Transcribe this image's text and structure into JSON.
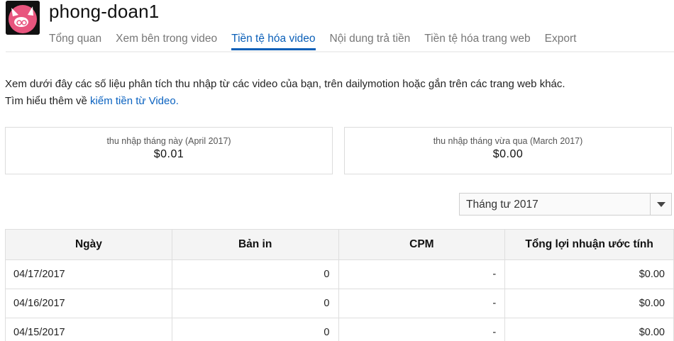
{
  "channel": {
    "name": "phong-doan1",
    "avatar_icon": "pink-mascot-icon"
  },
  "tabs": [
    {
      "label": "Tổng quan",
      "active": false
    },
    {
      "label": "Xem bên trong video",
      "active": false
    },
    {
      "label": "Tiền tệ hóa video",
      "active": true
    },
    {
      "label": "Nội dung trả tiền",
      "active": false
    },
    {
      "label": "Tiền tệ hóa trang web",
      "active": false
    },
    {
      "label": "Export",
      "active": false
    }
  ],
  "intro": {
    "line1": "Xem dưới đây các số liệu phân tích thu nhập từ các video của bạn, trên dailymotion hoặc gắn trên các trang web khác.",
    "line2_prefix": "Tìm hiểu thêm về ",
    "link_text": "kiếm tiền từ Video."
  },
  "cards": [
    {
      "label": "thu nhập tháng này (April 2017)",
      "value": "$0.01"
    },
    {
      "label": "thu nhập tháng vừa qua (March 2017)",
      "value": "$0.00"
    }
  ],
  "month_select": {
    "value": "Tháng tư 2017"
  },
  "table": {
    "headers": [
      "Ngày",
      "Bản in",
      "CPM",
      "Tổng lợi nhuận ước tính"
    ],
    "rows": [
      [
        "04/17/2017",
        "0",
        "-",
        "$0.00"
      ],
      [
        "04/16/2017",
        "0",
        "-",
        "$0.00"
      ],
      [
        "04/15/2017",
        "0",
        "-",
        "$0.00"
      ]
    ]
  },
  "colors": {
    "accent": "#0a5fb8",
    "link": "#0a62c0",
    "avatar_pink": "#e8557e"
  }
}
